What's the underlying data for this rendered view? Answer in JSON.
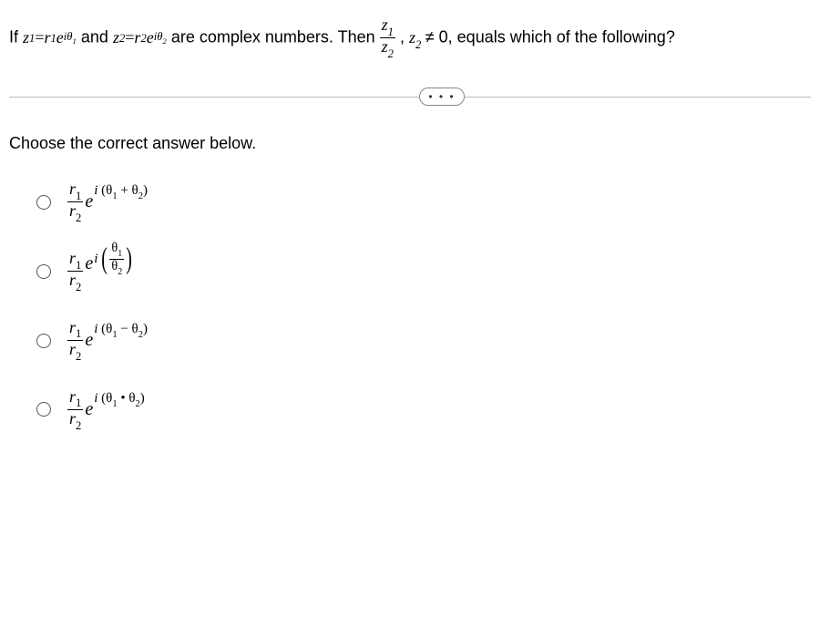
{
  "problem": {
    "prefix": "If ",
    "z1_lhs_var": "z",
    "z1_lhs_sub": "1",
    "eq1": " = ",
    "r1": "r",
    "r1_sub": "1",
    "e1": "e",
    "exp1_i": "i",
    "exp1_theta": "θ",
    "exp1_sub": "1",
    "and": " and ",
    "z2_lhs_var": "z",
    "z2_lhs_sub": "2",
    "eq2": " = ",
    "r2": "r",
    "r2_sub": "2",
    "e2": "e",
    "exp2_i": "i",
    "exp2_theta": "θ",
    "exp2_sub": "2",
    "mid": " are complex numbers. Then ",
    "frac_num_var": "z",
    "frac_num_sub": "1",
    "frac_den_var": "z",
    "frac_den_sub": "2",
    "comma": ", ",
    "cond_var": "z",
    "cond_sub": "2",
    "cond_rest": " ≠ 0, equals which of the following?"
  },
  "ellipsis": "• • •",
  "instruction": "Choose the correct answer below.",
  "options": {
    "a": {
      "frac_num": "r",
      "frac_num_sub": "1",
      "frac_den": "r",
      "frac_den_sub": "2",
      "e": "e",
      "i": "i",
      "lp": "(",
      "t1": "θ",
      "s1": "1",
      "op": " + ",
      "t2": "θ",
      "s2": "2",
      "rp": ")"
    },
    "b": {
      "frac_num": "r",
      "frac_num_sub": "1",
      "frac_den": "r",
      "frac_den_sub": "2",
      "e": "e",
      "i": "i",
      "inner_num": "θ",
      "inner_num_sub": "1",
      "inner_den": "θ",
      "inner_den_sub": "2"
    },
    "c": {
      "frac_num": "r",
      "frac_num_sub": "1",
      "frac_den": "r",
      "frac_den_sub": "2",
      "e": "e",
      "i": "i",
      "lp": "(",
      "t1": "θ",
      "s1": "1",
      "op": " − ",
      "t2": "θ",
      "s2": "2",
      "rp": ")"
    },
    "d": {
      "frac_num": "r",
      "frac_num_sub": "1",
      "frac_den": "r",
      "frac_den_sub": "2",
      "e": "e",
      "i": "i",
      "lp": "(",
      "t1": "θ",
      "s1": "1",
      "op": " • ",
      "t2": "θ",
      "s2": "2",
      "rp": ")"
    }
  }
}
